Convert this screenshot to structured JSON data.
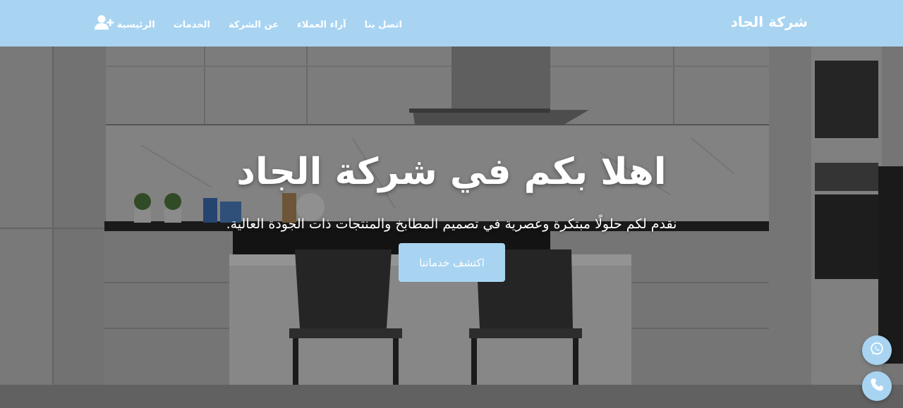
{
  "brand": {
    "name": "شركة الجاد"
  },
  "nav": {
    "items": [
      {
        "label": "الرئيسية"
      },
      {
        "label": "الخدمات"
      },
      {
        "label": "عن الشركة"
      },
      {
        "label": "آراء العملاء"
      },
      {
        "label": "اتصل بنا"
      }
    ],
    "user_icon": "user-plus-icon"
  },
  "hero": {
    "title": "اهلا بكم في شركة الجاد",
    "subtitle": "نقدم لكم حلولًا مبتكرة وعصرية في تصميم المطابخ والمنتجات ذات الجودة العالية.",
    "cta_label": "اكتشف خدماتنا"
  },
  "floating": {
    "whatsapp_icon": "whatsapp-icon",
    "phone_icon": "phone-icon"
  },
  "colors": {
    "accent": "#a8d4f2",
    "text_light": "#ffffff"
  }
}
